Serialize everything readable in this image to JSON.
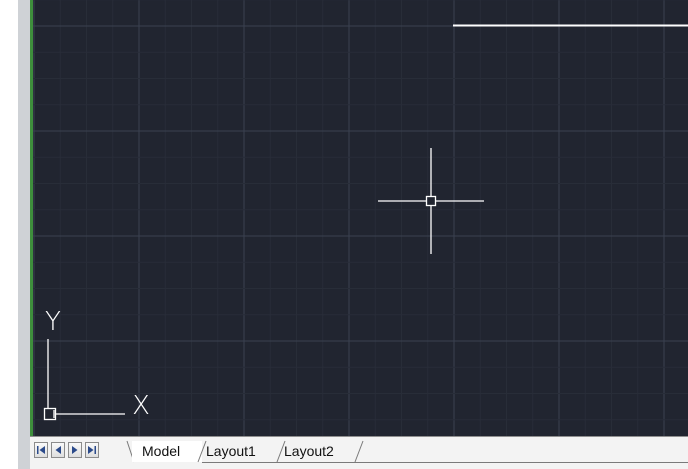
{
  "canvas": {
    "background_color": "#212530",
    "grid_color": "#2e3440",
    "crosshair_color": "#ffffff",
    "ucs": {
      "x_label": "X",
      "y_label": "Y"
    }
  },
  "layout_tabs": {
    "nav_buttons": [
      {
        "icon": "first-icon"
      },
      {
        "icon": "previous-icon"
      },
      {
        "icon": "next-icon"
      },
      {
        "icon": "last-icon"
      }
    ],
    "tabs": [
      {
        "label": "Model",
        "active": true
      },
      {
        "label": "Layout1",
        "active": false
      },
      {
        "label": "Layout2",
        "active": false
      }
    ]
  }
}
